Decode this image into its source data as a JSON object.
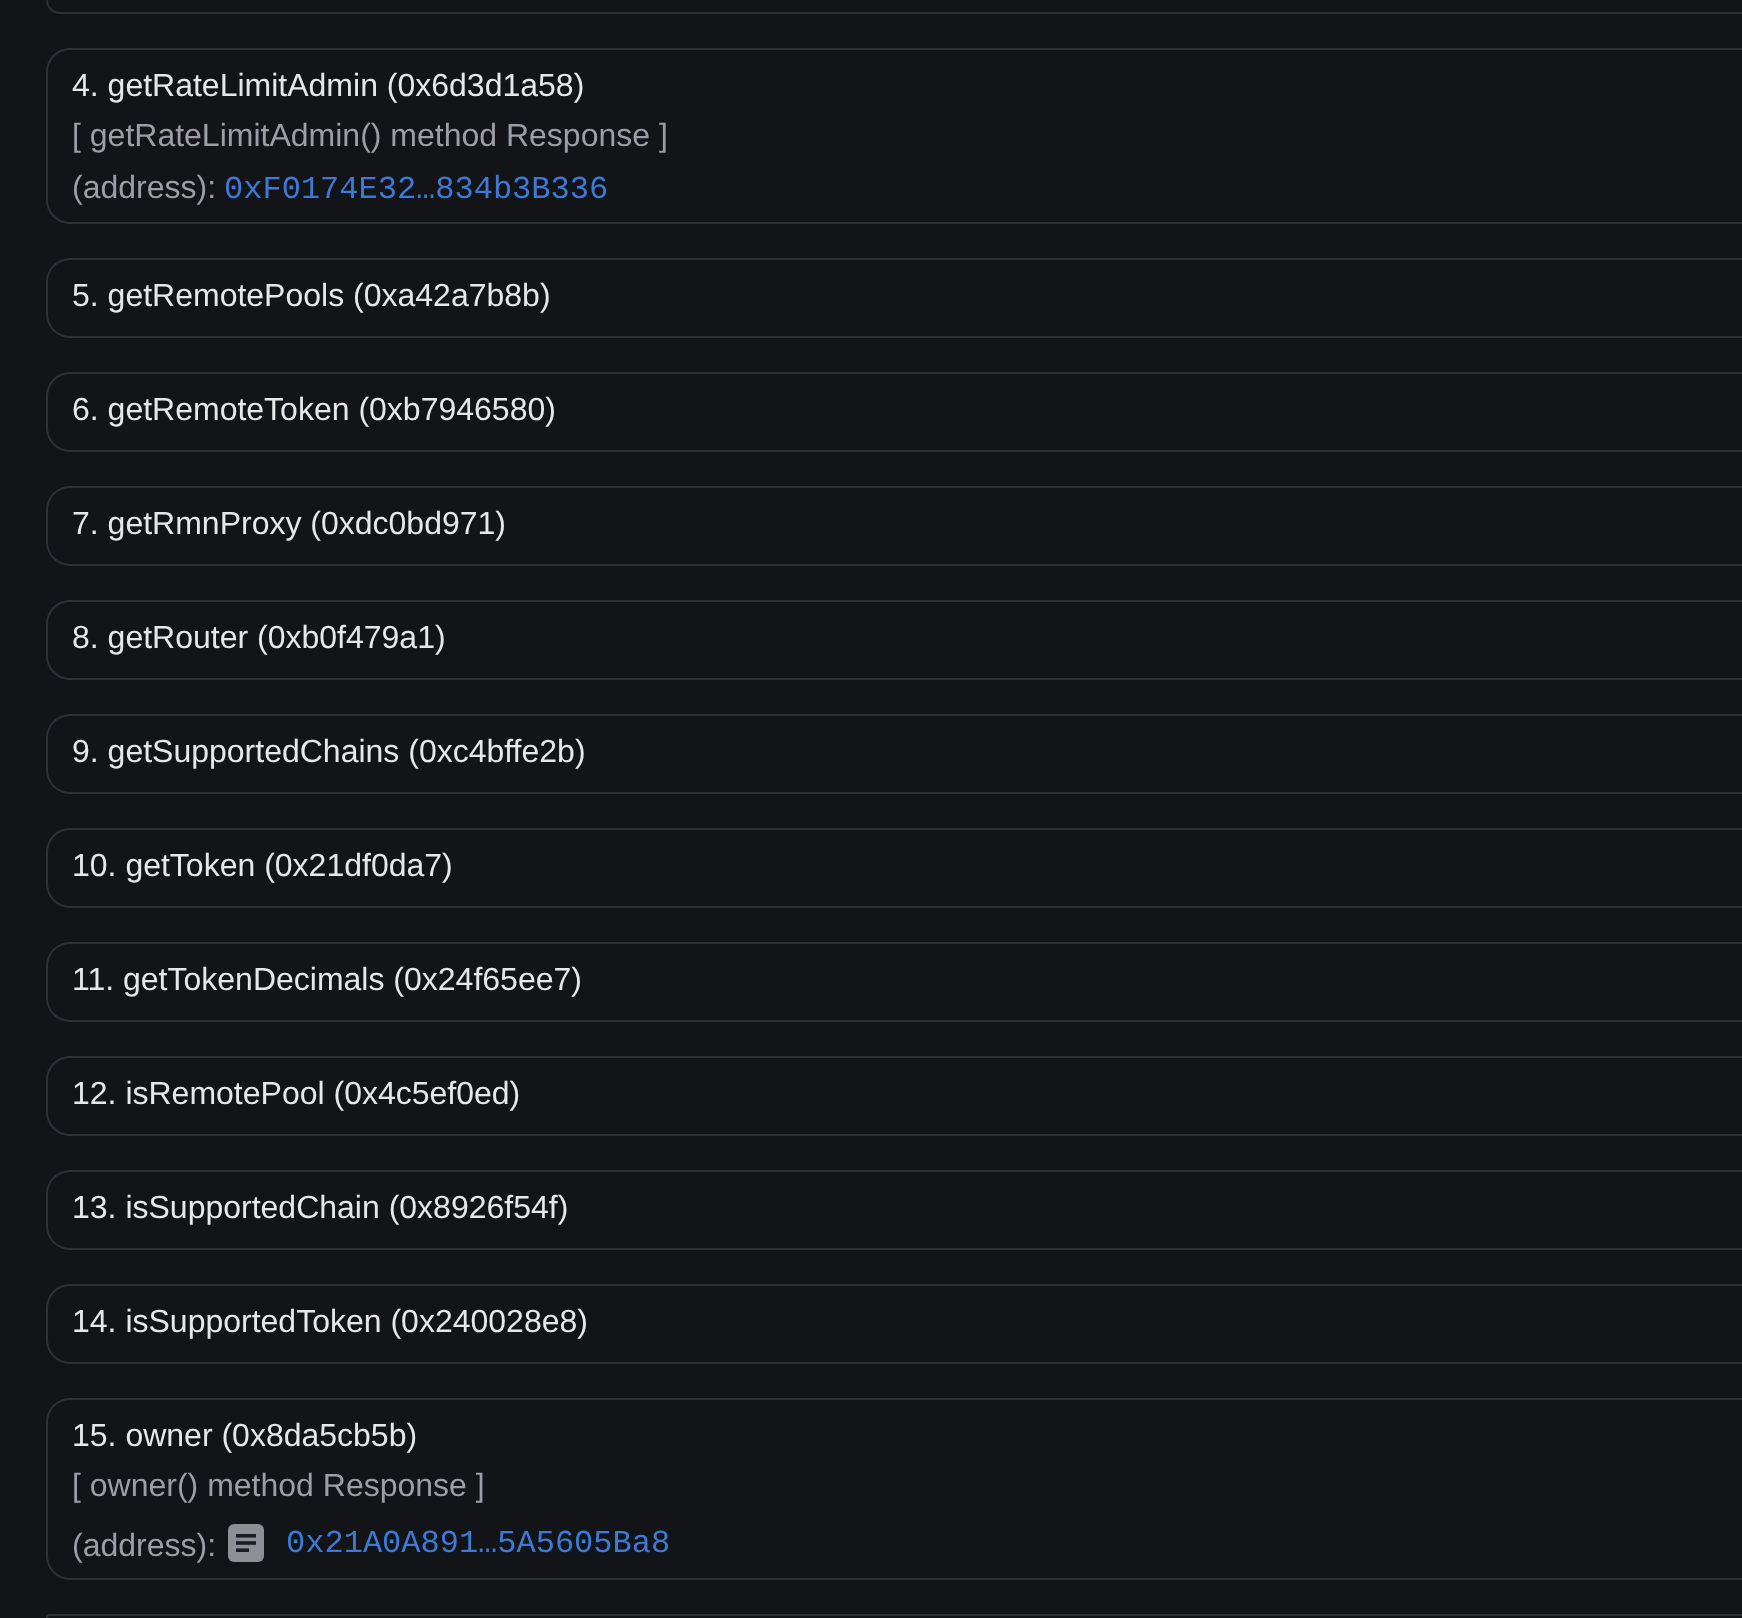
{
  "methods": [
    {
      "title": "4. getRateLimitAdmin (0x6d3d1a58)",
      "response": {
        "heading": "[ getRateLimitAdmin() method Response ]",
        "type_label": "(address):",
        "copy_icon": false,
        "value": "0xF0174E32…834b3B336"
      }
    },
    {
      "title": "5. getRemotePools (0xa42a7b8b)"
    },
    {
      "title": "6. getRemoteToken (0xb7946580)"
    },
    {
      "title": "7. getRmnProxy (0xdc0bd971)"
    },
    {
      "title": "8. getRouter (0xb0f479a1)"
    },
    {
      "title": "9. getSupportedChains (0xc4bffe2b)"
    },
    {
      "title": "10. getToken (0x21df0da7)"
    },
    {
      "title": "11. getTokenDecimals (0x24f65ee7)"
    },
    {
      "title": "12. isRemotePool (0x4c5ef0ed)"
    },
    {
      "title": "13. isSupportedChain (0x8926f54f)"
    },
    {
      "title": "14. isSupportedToken (0x240028e8)"
    },
    {
      "title": "15. owner (0x8da5cb5b)",
      "response": {
        "heading": "[ owner() method Response ]",
        "type_label": "(address):",
        "copy_icon": true,
        "value": "0x21A0A891…5A5605Ba8"
      }
    }
  ]
}
